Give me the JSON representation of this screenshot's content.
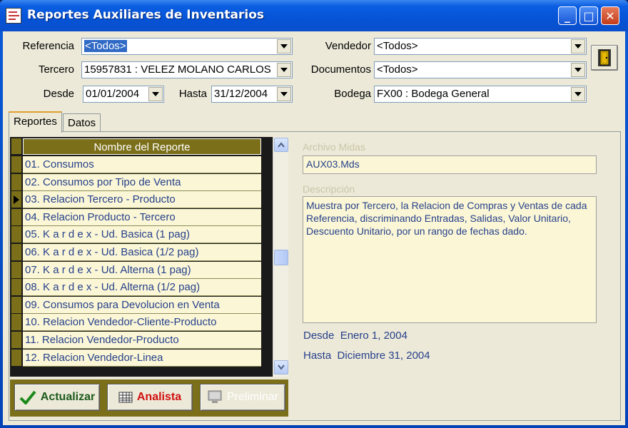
{
  "window": {
    "title": "Reportes Auxiliares de Inventarios",
    "minimize": "_",
    "maximize": "□",
    "close": "✕"
  },
  "filters": {
    "referencia": {
      "label": "Referencia",
      "value": "<Todos>"
    },
    "tercero": {
      "label": "Tercero",
      "value": "15957831 : VELEZ MOLANO CARLOS"
    },
    "desde": {
      "label": "Desde",
      "value": "01/01/2004"
    },
    "hasta": {
      "label": "Hasta",
      "value": "31/12/2004"
    },
    "vendedor": {
      "label": "Vendedor",
      "value": "<Todos>"
    },
    "documentos": {
      "label": "Documentos",
      "value": "<Todos>"
    },
    "bodega": {
      "label": "Bodega",
      "value": "FX00 : Bodega General"
    }
  },
  "tabs": [
    {
      "label": "Reportes"
    },
    {
      "label": "Datos"
    }
  ],
  "grid": {
    "header": "Nombre del Reporte",
    "selected_index": 2,
    "rows": [
      "01. Consumos",
      "02. Consumos por Tipo de Venta",
      "03. Relacion Tercero - Producto",
      "04. Relacion Producto - Tercero",
      "05. K a r d e x - Ud. Basica (1 pag)",
      "06. K a r d e x - Ud. Basica (1/2 pag)",
      "07. K a r d e x - Ud. Alterna (1 pag)",
      "08. K a r d e x - Ud. Alterna (1/2 pag)",
      "09. Consumos para Devolucion en Venta",
      "10. Relacion Vendedor-Cliente-Producto",
      "11. Relacion Vendedor-Producto",
      "12. Relacion Vendedor-Linea"
    ]
  },
  "buttons": {
    "actualizar": "Actualizar",
    "analista": "Analista",
    "preliminar": "Preliminar"
  },
  "details": {
    "archivo_label": "Archivo Midas",
    "archivo_value": "AUX03.Mds",
    "descripcion_label": "Descripción",
    "descripcion_value": "Muestra por Tercero, la Relacion de Compras y Ventas de cada Referencia, discriminando  Entradas, Salidas, Valor Unitario, Descuento Unitario, por un rango de fechas dado.",
    "desde_label": "Desde",
    "desde_value": "Enero 1, 2004",
    "hasta_label": "Hasta",
    "hasta_value": "Diciembre 31, 2004"
  },
  "colors": {
    "accent": "#7b6f19",
    "row_bg": "#fbf7d6",
    "row_text": "#27408b",
    "title_bar": "#0653d6"
  },
  "icons": [
    "report-app-icon",
    "exit-door-icon",
    "checkmark-icon",
    "calculator-icon",
    "monitor-icon"
  ]
}
